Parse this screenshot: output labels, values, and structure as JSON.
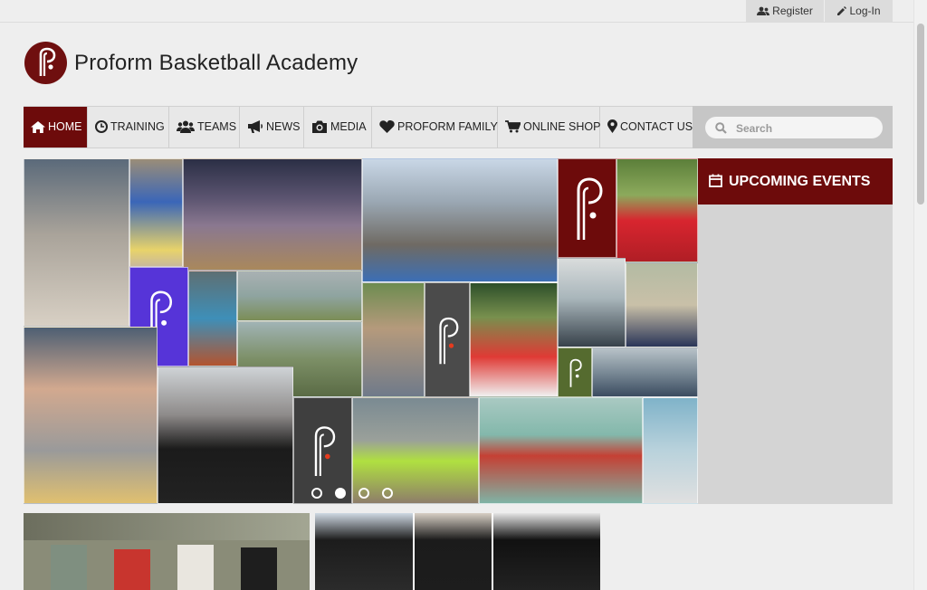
{
  "topbar": {
    "register": "Register",
    "login": "Log-In"
  },
  "brand": {
    "title": "Proform Basketball Academy",
    "color": "#6d0b0b"
  },
  "nav": {
    "items": [
      {
        "label": "HOME",
        "icon": "home-icon",
        "active": true
      },
      {
        "label": "TRAINING",
        "icon": "clock-icon"
      },
      {
        "label": "TEAMS",
        "icon": "users-icon"
      },
      {
        "label": "NEWS",
        "icon": "bullhorn-icon"
      },
      {
        "label": "MEDIA",
        "icon": "camera-icon"
      },
      {
        "label": "PROFORM FAMILY",
        "icon": "heart-icon"
      },
      {
        "label": "ONLINE SHOP",
        "icon": "cart-icon"
      },
      {
        "label": "CONTACT US",
        "icon": "map-marker-icon"
      }
    ],
    "search_placeholder": "Search"
  },
  "slider": {
    "dots": 4,
    "active_dot": 2
  },
  "events": {
    "title": "UPCOMING EVENTS",
    "icon": "calendar-icon"
  }
}
